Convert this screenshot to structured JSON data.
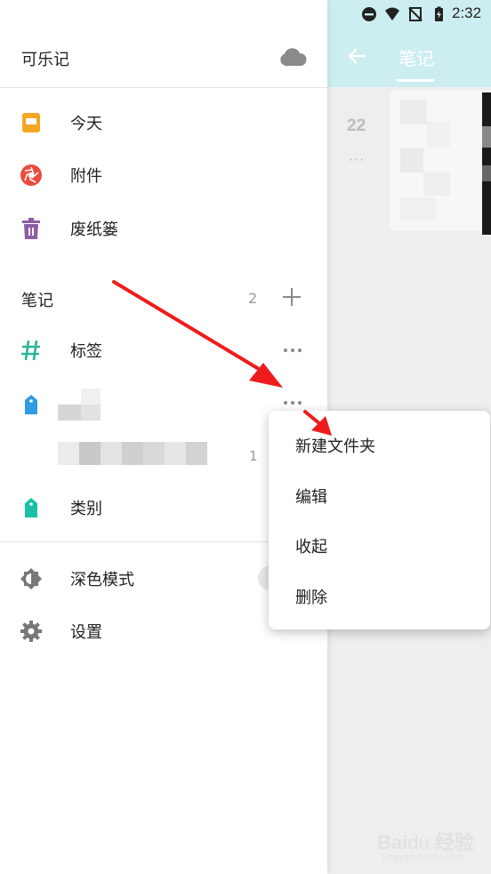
{
  "status_bar": {
    "time": "2:32"
  },
  "background_app": {
    "title": "笔记",
    "note_date": "22",
    "note_dots": "···"
  },
  "drawer": {
    "title": "可乐记",
    "cloud_icon": "cloud-icon",
    "nav_items": [
      {
        "label": "今天",
        "icon": "calendar-icon",
        "color": "#f5a623"
      },
      {
        "label": "附件",
        "icon": "aperture-icon",
        "color": "#e94b3c"
      },
      {
        "label": "废纸篓",
        "icon": "trash-icon",
        "color": "#8e5ea2"
      }
    ],
    "section": {
      "label": "笔记",
      "count": "2"
    },
    "tag_item": {
      "label": "标签",
      "icon": "hash-icon",
      "color": "#2bb39a"
    },
    "blurred_item_count": "1",
    "category_item": {
      "label": "类别",
      "icon": "tag-icon",
      "color": "#17c1a6"
    },
    "blurred_tag_color": "#2f9be2",
    "dark_mode": {
      "label": "深色模式",
      "icon": "contrast-icon"
    },
    "settings": {
      "label": "设置",
      "icon": "gear-icon"
    }
  },
  "context_menu": {
    "items": [
      "新建文件夹",
      "编辑",
      "收起",
      "删除"
    ]
  },
  "annotation": {
    "arrow_color": "#ee1c1c"
  }
}
